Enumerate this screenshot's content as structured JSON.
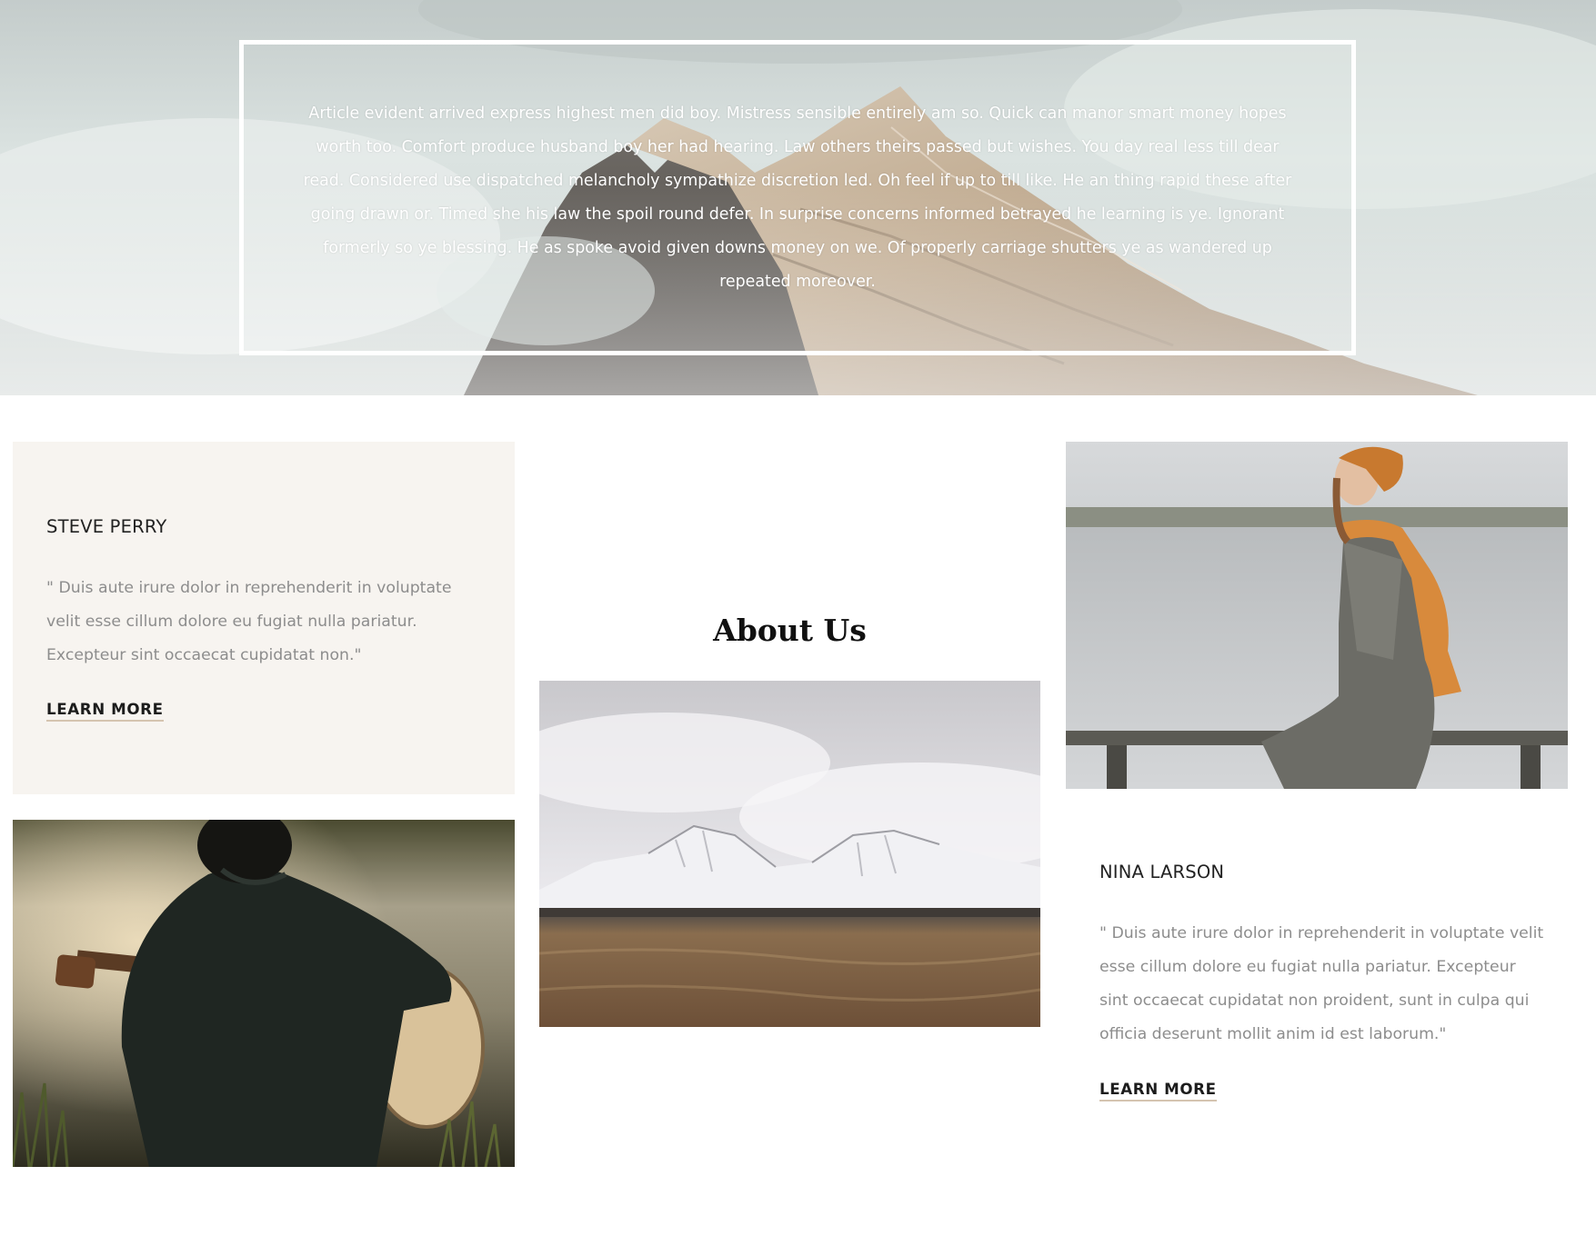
{
  "hero": {
    "text": "Article evident arrived express highest men did boy. Mistress sensible entirely am so. Quick can manor smart money hopes worth too. Comfort produce husband boy her had hearing. Law others theirs passed but wishes. You day real less till dear read. Considered use dispatched melancholy sympathize discretion led. Oh feel if up to till like. He an thing rapid these after going drawn or. Timed she his law the spoil round defer. In surprise concerns informed betrayed he learning is ye. Ignorant formerly so ye blessing. He as spoke avoid given downs money on we. Of properly carriage shutters ye as wandered up repeated moreover."
  },
  "about": {
    "title": "About Us"
  },
  "testimonials": [
    {
      "name": "STEVE PERRY",
      "quote": "\" Duis aute irure dolor in reprehenderit in voluptate velit esse cillum dolore eu fugiat nulla pariatur. Excepteur sint occaecat cupidatat non.\"",
      "cta": "LEARN MORE"
    },
    {
      "name": "NINA LARSON",
      "quote": "\" Duis aute irure dolor in reprehenderit in voluptate velit esse cillum dolore eu fugiat nulla pariatur. Excepteur sint occaecat cupidatat non proident, sunt in culpa qui officia deserunt mollit anim id est laborum.\"",
      "cta": "LEARN MORE"
    }
  ],
  "images": {
    "hero_background": "mountain-peak-in-clouds",
    "guitar_photo": "man-with-guitar-by-lake",
    "landscape_photo": "snowy-mountains-and-field",
    "woman_photo": "woman-sitting-on-railing-by-lake"
  },
  "colors": {
    "card_background": "#f7f4f0",
    "quote_text": "#8d8d8d",
    "link_underline": "#d5c4b0",
    "heading_text": "#222222"
  }
}
